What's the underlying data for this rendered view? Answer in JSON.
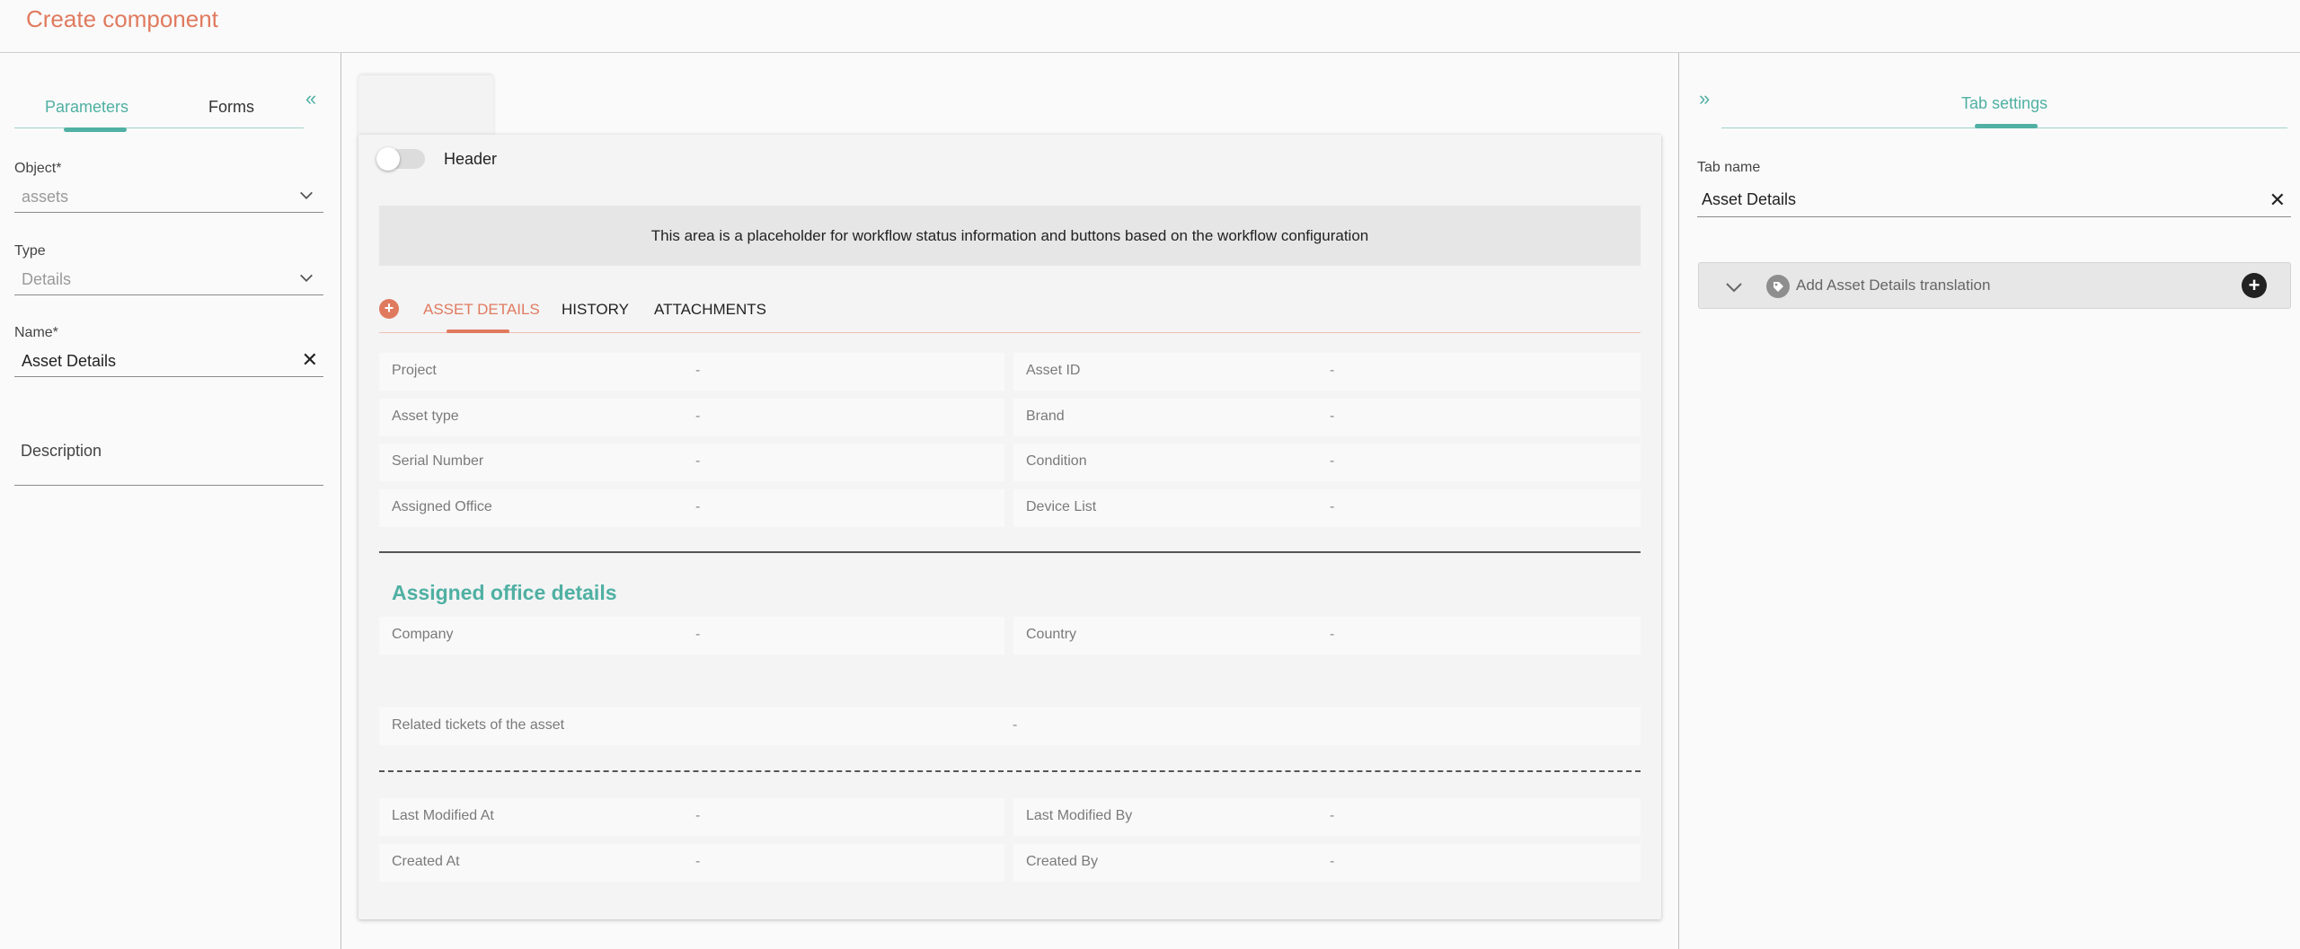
{
  "page": {
    "title": "Create component"
  },
  "left": {
    "tabs": [
      "Parameters",
      "Forms"
    ],
    "collapse_icon": "«",
    "fields": {
      "object": {
        "label": "Object*",
        "value": "assets"
      },
      "type": {
        "label": "Type",
        "value": "Details"
      },
      "name": {
        "label": "Name*",
        "value": "Asset Details"
      },
      "description": {
        "placeholder": "Description"
      }
    }
  },
  "center": {
    "header_label": "Header",
    "header_enabled": false,
    "placeholder_text": "This area is a placeholder for workflow status information and buttons based on the workflow configuration",
    "tabs": [
      "ASSET DETAILS",
      "HISTORY",
      "ATTACHMENTS"
    ],
    "active_tab": "ASSET DETAILS",
    "details_rows": [
      {
        "left_label": "Project",
        "left_value": "-",
        "right_label": "Asset ID",
        "right_value": "-"
      },
      {
        "left_label": "Asset type",
        "left_value": "-",
        "right_label": "Brand",
        "right_value": "-"
      },
      {
        "left_label": "Serial Number",
        "left_value": "-",
        "right_label": "Condition",
        "right_value": "-"
      },
      {
        "left_label": "Assigned Office",
        "left_value": "-",
        "right_label": "Device List",
        "right_value": "-"
      }
    ],
    "section_title": "Assigned office details",
    "office_row": {
      "left_label": "Company",
      "left_value": "-",
      "right_label": "Country",
      "right_value": "-"
    },
    "related_row": {
      "label": "Related tickets of the asset",
      "value": "-"
    },
    "meta_rows": [
      {
        "left_label": "Last Modified At",
        "left_value": "-",
        "right_label": "Last Modified By",
        "right_value": "-"
      },
      {
        "left_label": "Created At",
        "left_value": "-",
        "right_label": "Created By",
        "right_value": "-"
      }
    ]
  },
  "right": {
    "expand_icon": "»",
    "tab": "Tab settings",
    "tab_name": {
      "label": "Tab name",
      "value": "Asset Details"
    },
    "translation": {
      "label": "Add Asset Details translation"
    }
  },
  "colors": {
    "accent_teal": "#4fb0a3",
    "accent_orange": "#e07a5f"
  }
}
